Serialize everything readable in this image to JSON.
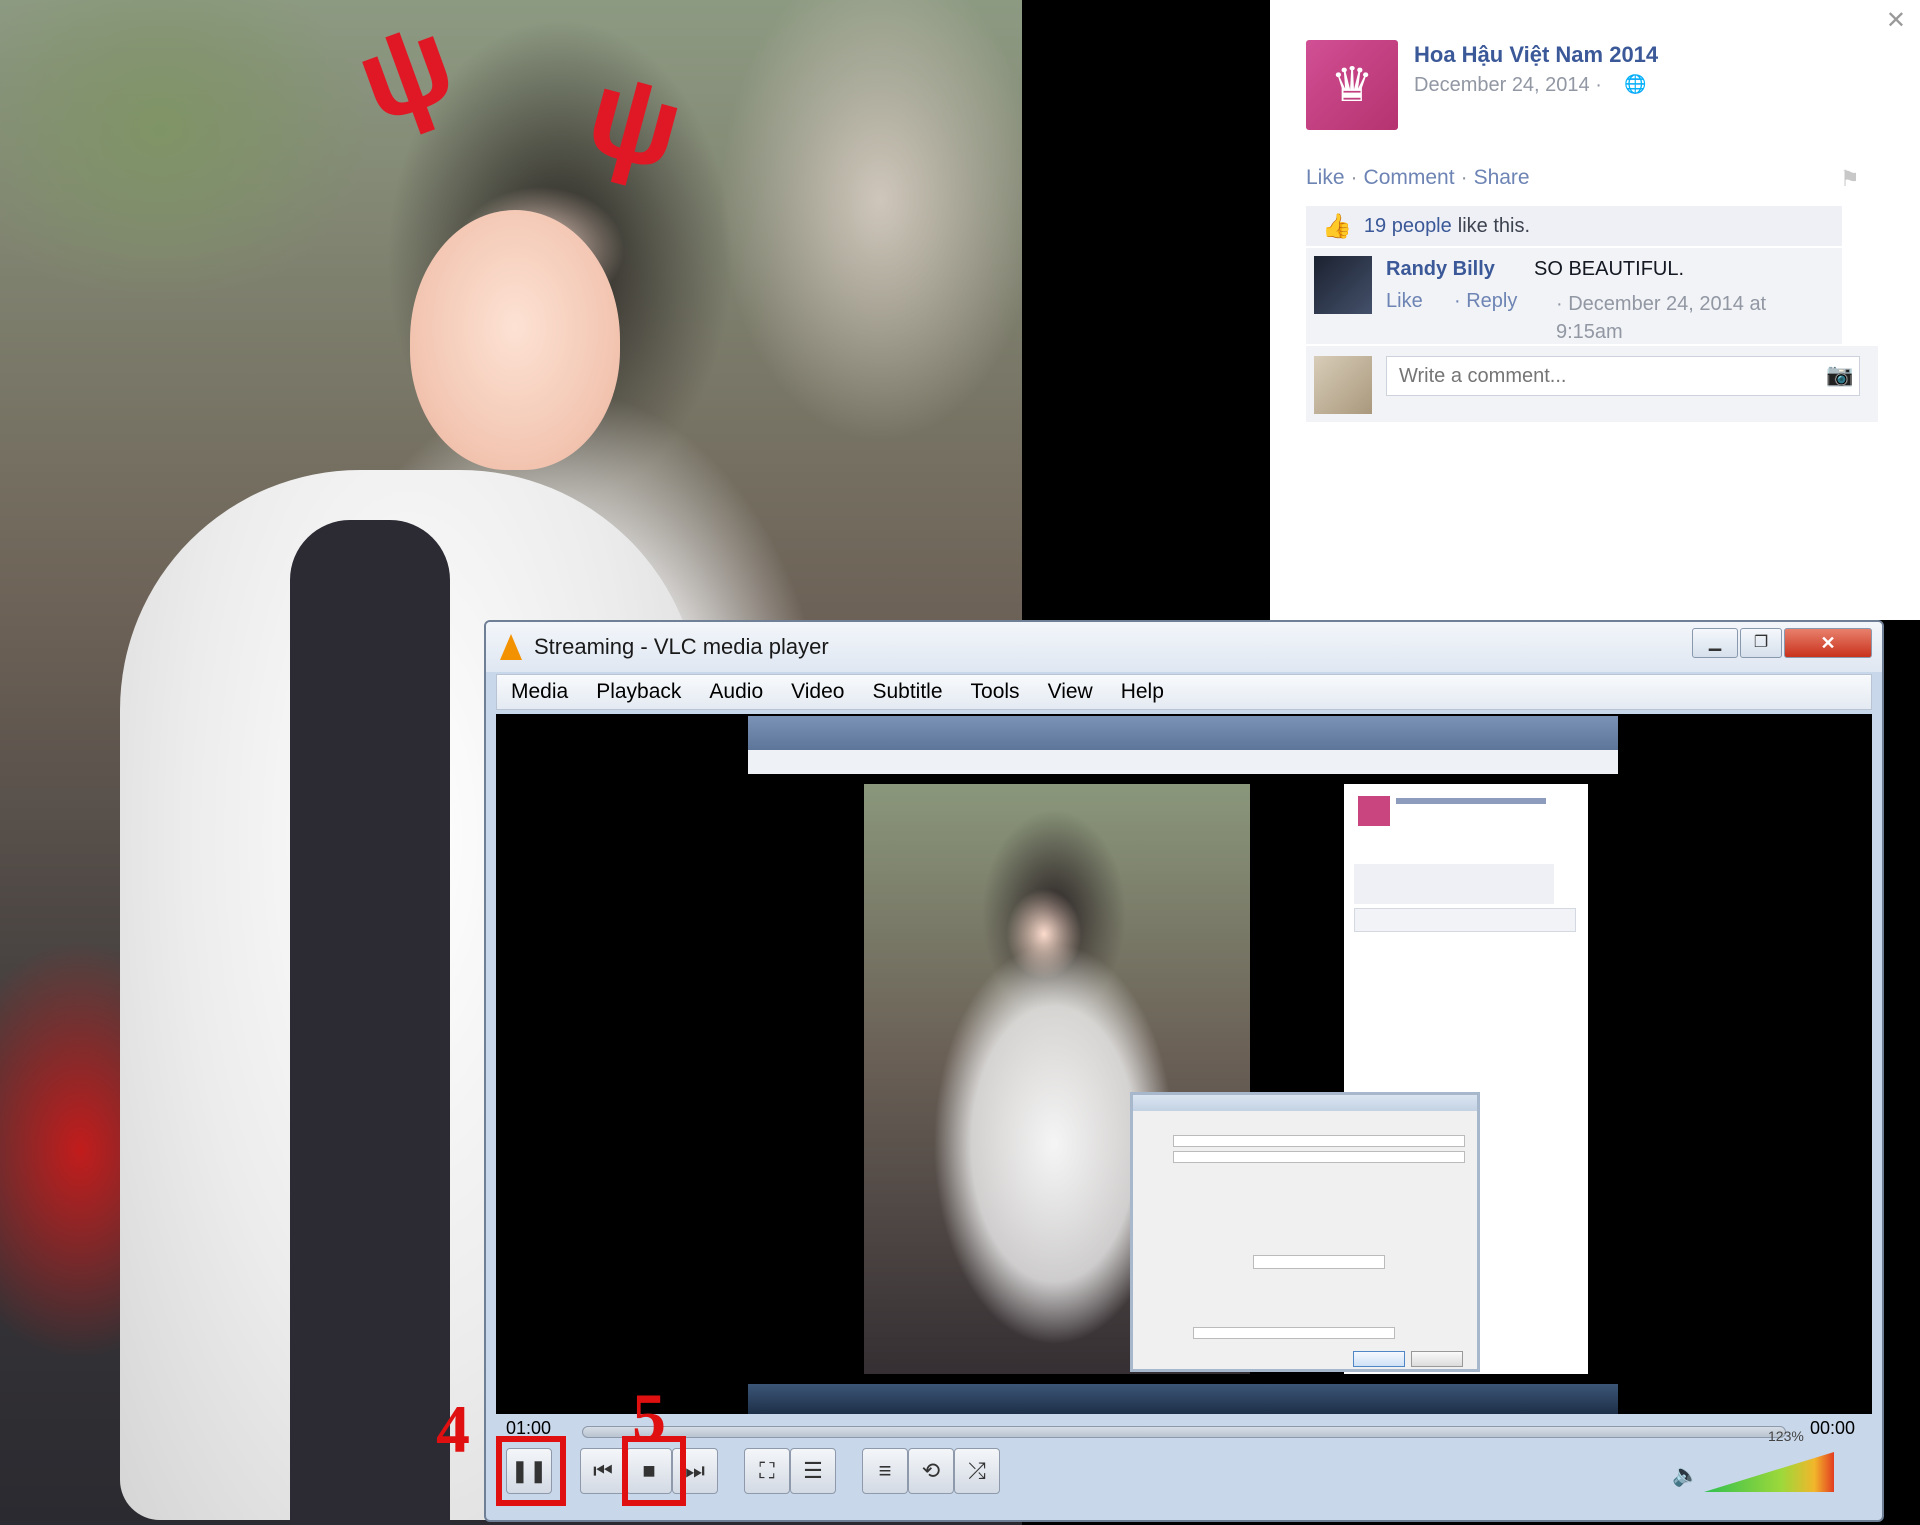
{
  "facebook": {
    "page_name": "Hoa Hậu Việt Nam 2014",
    "post_date": "December 24, 2014 ·",
    "actions": [
      "Like",
      "Comment",
      "Share"
    ],
    "likes_count": "19 people",
    "likes_suffix": "like this.",
    "comment": {
      "author": "Randy Billy",
      "text": "SO BEAUTIFUL.",
      "like": "Like",
      "reply": "· Reply",
      "date": "· December 24, 2014 at 9:15am"
    },
    "comment_placeholder": "Write a comment..."
  },
  "vlc": {
    "title": "Streaming - VLC media player",
    "menu": [
      "Media",
      "Playback",
      "Audio",
      "Video",
      "Subtitle",
      "Tools",
      "View",
      "Help"
    ],
    "time_elapsed": "01:00",
    "time_total": "00:00",
    "volume_label": "123%",
    "volume_level": 1.23
  },
  "annotations": {
    "step_pause": "4",
    "step_stop": "5"
  },
  "colors": {
    "facebook_link": "#3b5998",
    "annotation_red": "#e01010",
    "vlc_cone": "#f39200"
  },
  "icons": {
    "close": "close-icon",
    "globe": "globe-icon",
    "flag": "flag-icon",
    "thumb": "thumbs-up-icon",
    "camera": "camera-icon",
    "volume": "speaker-icon"
  }
}
